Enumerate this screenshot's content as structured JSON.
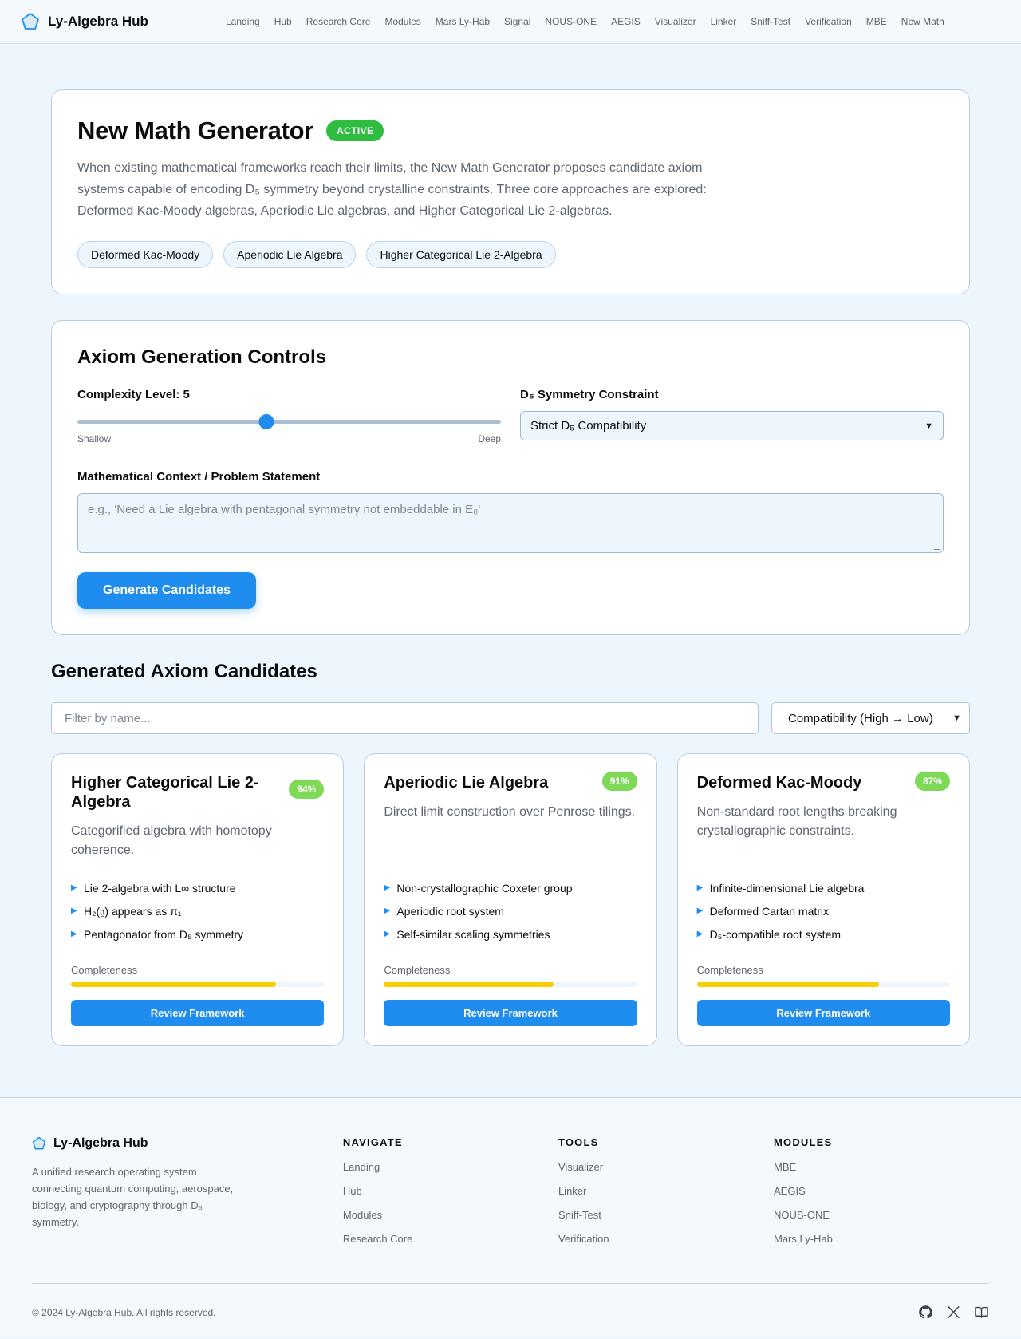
{
  "nav": {
    "brand": "Ly-Algebra Hub",
    "brand_icon": "pentagon-icon",
    "links": [
      "Landing",
      "Hub",
      "Research Core",
      "Modules",
      "Mars Ly-Hab",
      "Signal",
      "NOUS-ONE",
      "AEGIS",
      "Visualizer",
      "Linker",
      "Sniff-Test",
      "Verification",
      "MBE",
      "New Math"
    ]
  },
  "hero": {
    "title": "New Math Generator",
    "badge": "ACTIVE",
    "description": "When existing mathematical frameworks reach their limits, the New Math Generator proposes candidate axiom systems capable of encoding D₅ symmetry beyond crystalline constraints. Three core approaches are explored: Deformed Kac-Moody algebras, Aperiodic Lie algebras, and Higher Categorical Lie 2-algebras.",
    "chips": [
      "Deformed Kac-Moody",
      "Aperiodic Lie Algebra",
      "Higher Categorical Lie 2-Algebra"
    ]
  },
  "controls": {
    "title": "Axiom Generation Controls",
    "complexity_label": "Complexity Level: 5",
    "complexity_fraction": 0.447,
    "slider_min_label": "Shallow",
    "slider_max_label": "Deep",
    "symmetry_label": "D₅ Symmetry Constraint",
    "symmetry_value": "Strict D₅ Compatibility",
    "context_label": "Mathematical Context / Problem Statement",
    "context_placeholder": "e.g., 'Need a Lie algebra with pentagonal symmetry not embeddable in E₈'",
    "generate_label": "Generate Candidates"
  },
  "results": {
    "title": "Generated Axiom Candidates",
    "filter_placeholder": "Filter by name...",
    "sort_value": "Compatibility (High → Low)",
    "completeness_label": "Completeness",
    "review_label": "Review Framework",
    "candidates": [
      {
        "title": "Higher Categorical Lie 2-Algebra",
        "score": "94%",
        "description": "Categorified algebra with homotopy coherence.",
        "features": [
          "Lie 2-algebra with L∞ structure",
          "H₂(𝔤) appears as π₁",
          "Pentagonator from D₅ symmetry"
        ],
        "completeness": 0.81
      },
      {
        "title": "Aperiodic Lie Algebra",
        "score": "91%",
        "description": "Direct limit construction over Penrose tilings.",
        "features": [
          "Non-crystallographic Coxeter group",
          "Aperiodic root system",
          "Self-similar scaling symmetries"
        ],
        "completeness": 0.67
      },
      {
        "title": "Deformed Kac-Moody",
        "score": "87%",
        "description": "Non-standard root lengths breaking crystallographic constraints.",
        "features": [
          "Infinite-dimensional Lie algebra",
          "Deformed Cartan matrix",
          "D₅-compatible root system"
        ],
        "completeness": 0.72
      }
    ]
  },
  "footer": {
    "brand": "Ly-Algebra Hub",
    "description": "A unified research operating system connecting quantum computing, aerospace, biology, and cryptography through D₅ symmetry.",
    "columns": [
      {
        "title": "NAVIGATE",
        "links": [
          "Landing",
          "Hub",
          "Modules",
          "Research Core"
        ]
      },
      {
        "title": "TOOLS",
        "links": [
          "Visualizer",
          "Linker",
          "Sniff-Test",
          "Verification"
        ]
      },
      {
        "title": "MODULES",
        "links": [
          "MBE",
          "AEGIS",
          "NOUS-ONE",
          "Mars Ly-Hab"
        ]
      }
    ],
    "copyright": "© 2024 Ly-Algebra Hub. All rights reserved.",
    "socials": [
      "github-icon",
      "x-icon",
      "book-icon"
    ]
  },
  "colors": {
    "accent": "#1f8cf0",
    "active_badge": "#2ebd3f",
    "score_badge": "#7ed957",
    "completeness_fill": "#f7cf07",
    "page_bg": "#eef6fd"
  }
}
